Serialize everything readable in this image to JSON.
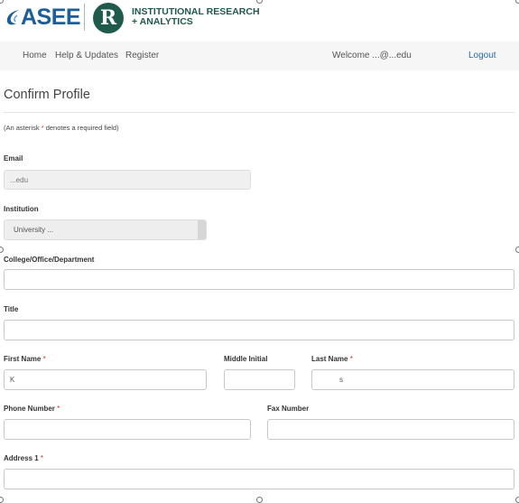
{
  "brand": {
    "asee_logo_text": "ASEE",
    "ira_monogram": "R",
    "ira_line1": "INSTITUTIONAL RESEARCH",
    "ira_line2": "+ ANALYTICS",
    "primary_color": "#1b5e9a",
    "secondary_color": "#1f5a4c"
  },
  "nav": {
    "items": [
      "Home",
      "Help & Updates",
      "Register"
    ],
    "welcome_text": "Welcome ",
    "email_display": "...@...edu",
    "logout_label": "Logout",
    "link_color": "#2a6aa8"
  },
  "page": {
    "title": "Confirm Profile",
    "note_prefix": "(An asterisk ",
    "note_asterisk": "*",
    "note_suffix": " denotes a required field)"
  },
  "form": {
    "required_marker": "*",
    "email": {
      "label": "Email",
      "value": "...edu"
    },
    "institution": {
      "label": "Institution",
      "value": "University ..."
    },
    "department": {
      "label": "College/Office/Department",
      "value": ""
    },
    "title": {
      "label": "Title",
      "value": ""
    },
    "first_name": {
      "label": "First Name",
      "value": "K"
    },
    "middle_initial": {
      "label": "Middle Initial",
      "value": ""
    },
    "last_name": {
      "label": "Last Name",
      "value": "s"
    },
    "phone": {
      "label": "Phone Number",
      "value": ""
    },
    "fax": {
      "label": "Fax Number",
      "value": ""
    },
    "address1": {
      "label": "Address 1",
      "value": ""
    }
  }
}
